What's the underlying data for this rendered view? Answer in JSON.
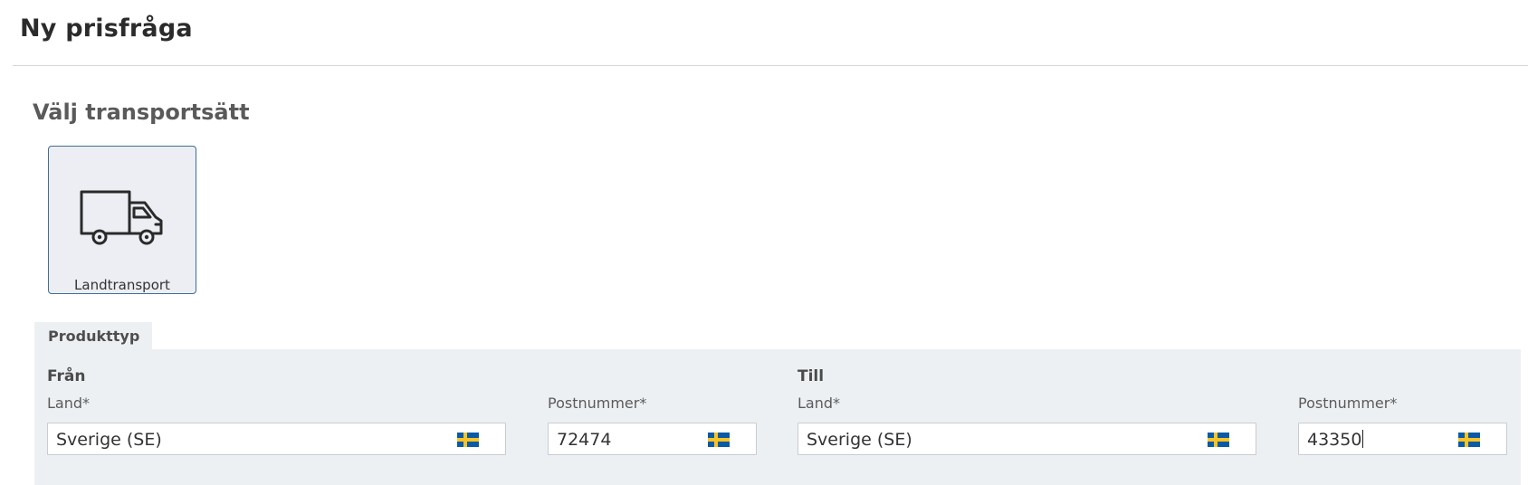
{
  "page": {
    "title": "Ny prisfråga"
  },
  "transport": {
    "section_title": "Välj transportsätt",
    "modes": [
      {
        "label": "Landtransport",
        "icon": "truck-icon",
        "selected": true
      }
    ]
  },
  "product": {
    "tab_label": "Produkttyp"
  },
  "from": {
    "heading": "Från",
    "country_label": "Land*",
    "country_value": "Sverige (SE)",
    "postal_label": "Postnummer*",
    "postal_value": "72474"
  },
  "to": {
    "heading": "Till",
    "country_label": "Land*",
    "country_value": "Sverige (SE)",
    "postal_label": "Postnummer*",
    "postal_value": "43350"
  },
  "colors": {
    "accent_border": "#3f6e94",
    "panel_bg": "#edf0f3",
    "flag_blue": "#0a5aa5",
    "flag_yellow": "#f7c325"
  }
}
